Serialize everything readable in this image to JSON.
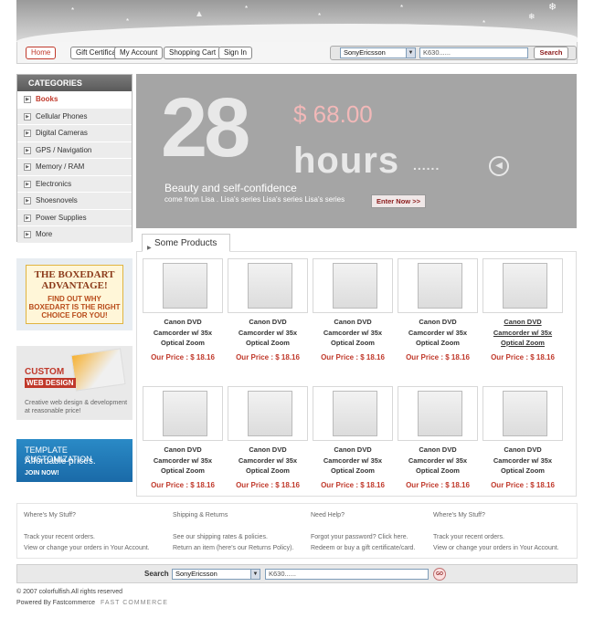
{
  "nav": {
    "home": "Home",
    "gift": "Gift Certificate",
    "account": "My Account",
    "cart": "Shopping Cart",
    "signin": "Sign In"
  },
  "search": {
    "category": "SonyEricsson",
    "query": "K630......",
    "button": "Search"
  },
  "categories": {
    "title": "CATEGORIES",
    "items": [
      "Books",
      "Cellular Phones",
      "Digital Cameras",
      "GPS / Navigation",
      "Memory / RAM",
      "Electronics",
      "Shoesnovels",
      "Power Supplies",
      "More"
    ],
    "active_index": 0
  },
  "ads": {
    "boxedart_title": "THE BOXEDART ADVANTAGE!",
    "boxedart_sub": "FIND OUT WHY BOXEDART IS THE RIGHT CHOICE FOR YOU!",
    "custom_title": "CUSTOM",
    "custom_sub": "WEB DESIGN",
    "custom_text": "Creative web design & development at reasonable price!",
    "template_title": "TEMPLATE CUSTOMIZATION",
    "template_sub": "Affordable prices.",
    "template_cta": "JOIN NOW!"
  },
  "promo": {
    "number": "28",
    "price": "$ 68.00",
    "unit": "hours",
    "dots": "......",
    "headline": "Beauty and self-confidence",
    "subline": "come from Lisa . Lisa's series Lisa's series Lisa's series",
    "button": "Enter Now >>"
  },
  "products": {
    "tab_label": "Some Products",
    "items": [
      {
        "line1": "Canon DVD",
        "line2": "Camcorder w/ 35x",
        "line3": "Optical Zoom",
        "price": "Our Price : $ 18.16"
      },
      {
        "line1": "Canon DVD",
        "line2": "Camcorder w/ 35x",
        "line3": "Optical Zoom",
        "price": "Our Price : $ 18.16"
      },
      {
        "line1": "Canon DVD",
        "line2": "Camcorder w/ 35x",
        "line3": "Optical Zoom",
        "price": "Our Price : $ 18.16"
      },
      {
        "line1": "Canon DVD",
        "line2": "Camcorder w/ 35x",
        "line3": "Optical Zoom",
        "price": "Our Price : $ 18.16"
      },
      {
        "line1": "Canon DVD",
        "line2": "Camcorder w/ 35x",
        "line3": "Optical Zoom",
        "price": "Our Price : $ 18.16"
      },
      {
        "line1": "Canon DVD",
        "line2": "Camcorder w/ 35x",
        "line3": "Optical Zoom",
        "price": "Our Price : $ 18.16"
      },
      {
        "line1": "Canon DVD",
        "line2": "Camcorder w/ 35x",
        "line3": "Optical Zoom",
        "price": "Our Price : $ 18.16"
      },
      {
        "line1": "Canon DVD",
        "line2": "Camcorder w/ 35x",
        "line3": "Optical Zoom",
        "price": "Our Price : $ 18.16"
      },
      {
        "line1": "Canon DVD",
        "line2": "Camcorder w/ 35x",
        "line3": "Optical Zoom",
        "price": "Our Price : $ 18.16"
      },
      {
        "line1": "Canon DVD",
        "line2": "Camcorder w/ 35x",
        "line3": "Optical Zoom",
        "price": "Our Price : $ 18.16"
      }
    ]
  },
  "footer": {
    "col1": {
      "heading": "Where's My Stuff?",
      "l1": "Track your recent orders.",
      "l2": "View or change your orders in Your Account."
    },
    "col2": {
      "heading": "Shipping & Returns",
      "l1": "See our shipping rates & policies.",
      "l2": "Return an item (here's our Returns Policy)."
    },
    "col3": {
      "heading": "Need Help?",
      "l1": "Forgot your password? Click here.",
      "l2": "Redeem or buy a gift certificate/card."
    },
    "col4": {
      "heading": "Where's My Stuff?",
      "l1": "Track your recent orders.",
      "l2": "View or change your orders in Your Account."
    }
  },
  "bottom_search": {
    "label": "Search",
    "category": "SonyEricsson",
    "query": "K630......",
    "button": "GO"
  },
  "copyright": "© 2007 colorfulfish.All rights reserved",
  "powered_by": "Powered By Fastcommerce",
  "powered_logo": "FAST COMMERCE",
  "colors": {
    "accent": "#c0392b",
    "banner_gray": "#a5a5a5",
    "category_header": "#6a6a6a"
  }
}
